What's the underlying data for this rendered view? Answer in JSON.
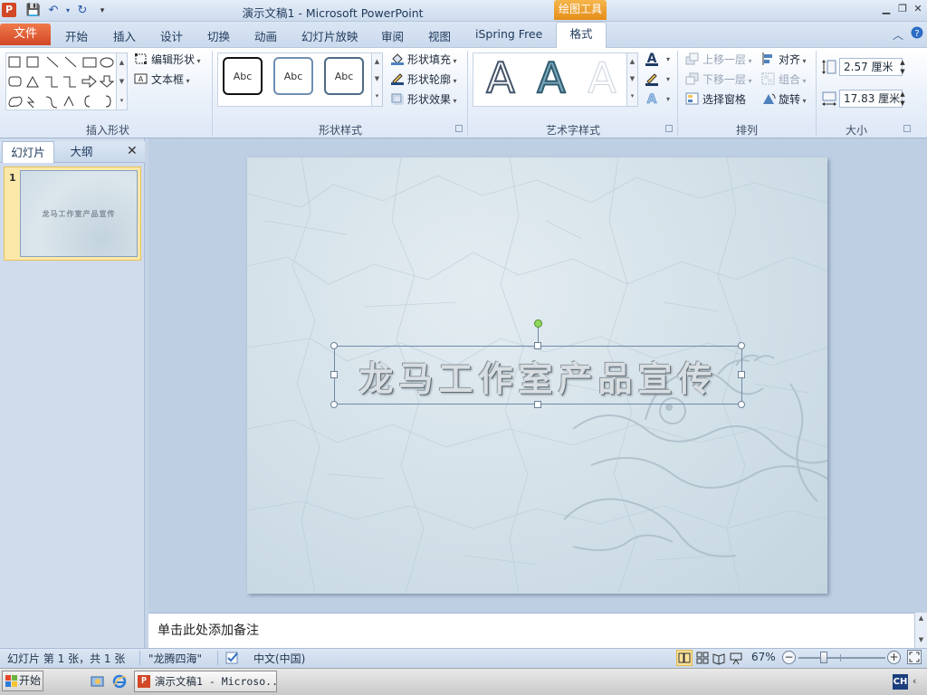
{
  "window": {
    "title": "演示文稿1 - Microsoft PowerPoint",
    "context_group": "绘图工具",
    "app_icon": "P"
  },
  "tabs": {
    "file": "文件",
    "items": [
      "开始",
      "插入",
      "设计",
      "切换",
      "动画",
      "幻灯片放映",
      "审阅",
      "视图",
      "iSpring Free"
    ],
    "active": "格式"
  },
  "ribbon": {
    "insert_shapes": {
      "label": "插入形状",
      "edit_shape": "编辑形状",
      "text_box": "文本框"
    },
    "shape_styles": {
      "label": "形状样式",
      "swatches": [
        "Abc",
        "Abc",
        "Abc"
      ],
      "fill": "形状填充",
      "outline": "形状轮廓",
      "effects": "形状效果"
    },
    "wordart_styles": {
      "label": "艺术字样式",
      "samples": [
        "A",
        "A",
        "A"
      ]
    },
    "arrange": {
      "label": "排列",
      "bring_forward": "上移一层",
      "send_backward": "下移一层",
      "selection_pane": "选择窗格",
      "align": "对齐",
      "group": "组合",
      "rotate": "旋转"
    },
    "size": {
      "label": "大小",
      "height": "2.57 厘米",
      "width": "17.83 厘米"
    }
  },
  "left_panel": {
    "tab_slides": "幻灯片",
    "tab_outline": "大纲",
    "close": "✕",
    "slide_number": "1",
    "thumb_title": "龙马工作室产品宣传"
  },
  "slide": {
    "title": "龙马工作室产品宣传"
  },
  "notes": {
    "placeholder": "单击此处添加备注"
  },
  "status": {
    "slide_info": "幻灯片 第 1 张，共 1 张",
    "theme": "\"龙腾四海\"",
    "language": "中文(中国)",
    "zoom": "67%"
  },
  "taskbar": {
    "start": "开始",
    "task_item": "演示文稿1 - Microso...",
    "ime": "CH"
  },
  "colors": {
    "file_tab": "#d24726",
    "context_group": "#e48d18",
    "ribbon_bg": "#e9f0fa",
    "slide_bg": "#d2e0e8"
  }
}
